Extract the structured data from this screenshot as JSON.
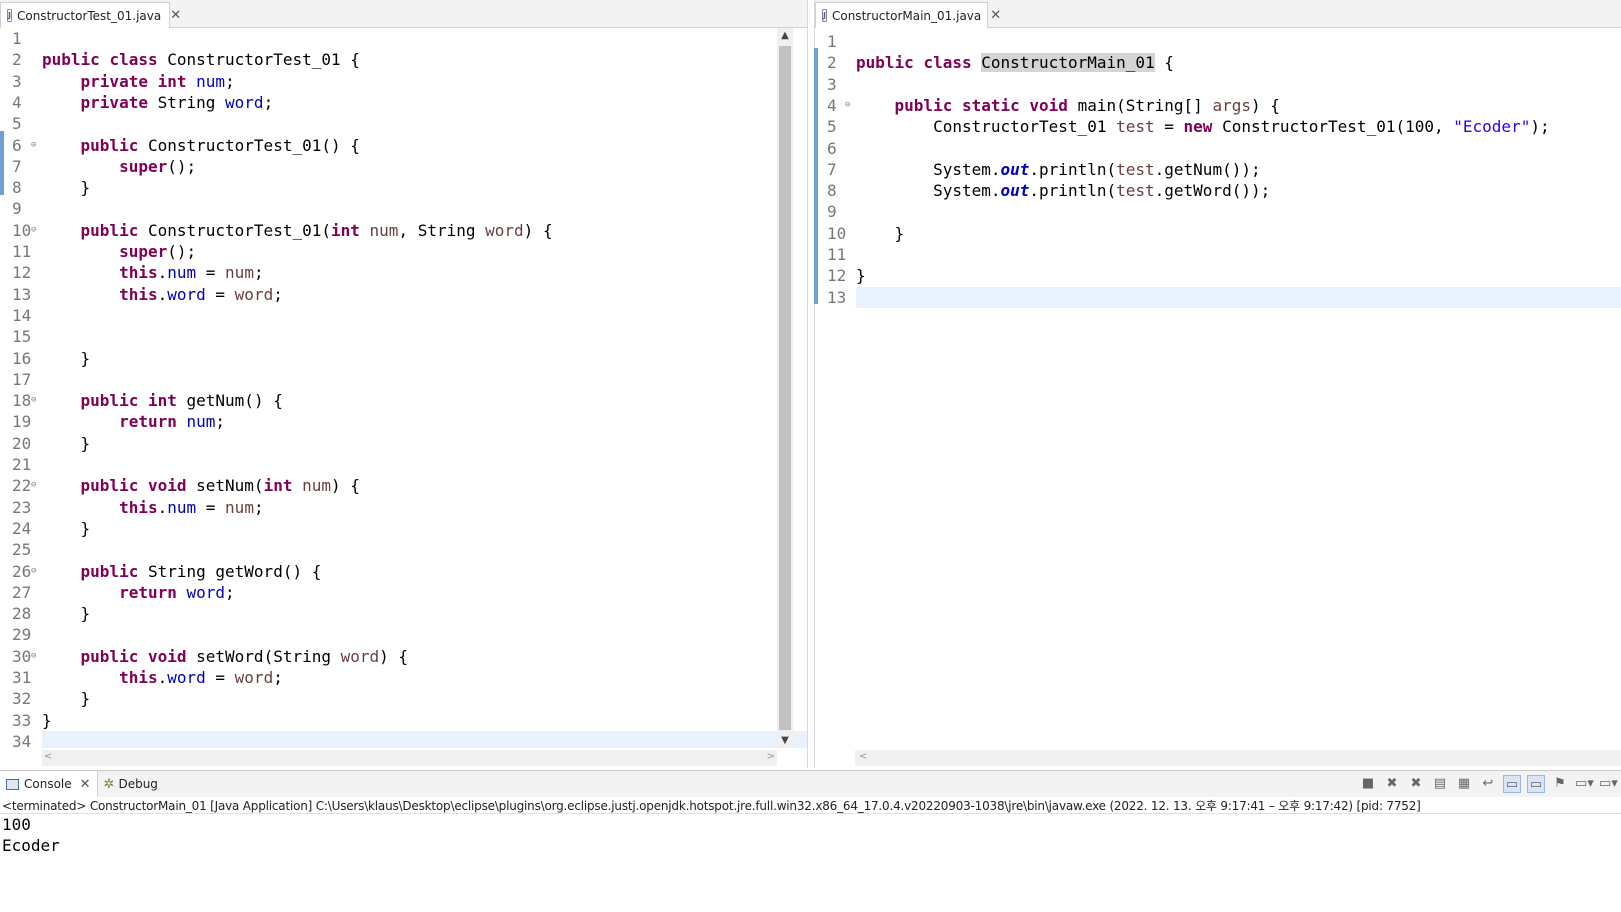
{
  "left_editor": {
    "tab_label": "ConstructorTest_01.java",
    "lines": [
      {
        "n": "1",
        "html": ""
      },
      {
        "n": "2",
        "html": "<span class=\"kw\">public</span> <span class=\"kw\">class</span> ConstructorTest_01 {"
      },
      {
        "n": "3",
        "html": "    <span class=\"kw\">private</span> <span class=\"kw\">int</span> <span class=\"fld\">num</span>;"
      },
      {
        "n": "4",
        "html": "    <span class=\"kw\">private</span> String <span class=\"fld\">word</span>;"
      },
      {
        "n": "5",
        "html": ""
      },
      {
        "n": "6",
        "fold": true,
        "html": "    <span class=\"kw\">public</span> ConstructorTest_01() {"
      },
      {
        "n": "7",
        "html": "        <span class=\"kw\">super</span>();"
      },
      {
        "n": "8",
        "html": "    }"
      },
      {
        "n": "9",
        "html": ""
      },
      {
        "n": "10",
        "fold": true,
        "html": "    <span class=\"kw\">public</span> ConstructorTest_01(<span class=\"kw\">int</span> <span class=\"par\">num</span>, String <span class=\"par\">word</span>) {"
      },
      {
        "n": "11",
        "html": "        <span class=\"kw\">super</span>();"
      },
      {
        "n": "12",
        "html": "        <span class=\"kw\">this</span>.<span class=\"fld\">num</span> = <span class=\"par\">num</span>;"
      },
      {
        "n": "13",
        "html": "        <span class=\"kw\">this</span>.<span class=\"fld\">word</span> = <span class=\"par\">word</span>;"
      },
      {
        "n": "14",
        "html": ""
      },
      {
        "n": "15",
        "html": ""
      },
      {
        "n": "16",
        "html": "    }"
      },
      {
        "n": "17",
        "html": ""
      },
      {
        "n": "18",
        "fold": true,
        "html": "    <span class=\"kw\">public</span> <span class=\"kw\">int</span> getNum() {"
      },
      {
        "n": "19",
        "html": "        <span class=\"kw\">return</span> <span class=\"fld\">num</span>;"
      },
      {
        "n": "20",
        "html": "    }"
      },
      {
        "n": "21",
        "html": ""
      },
      {
        "n": "22",
        "fold": true,
        "html": "    <span class=\"kw\">public</span> <span class=\"kw\">void</span> setNum(<span class=\"kw\">int</span> <span class=\"par\">num</span>) {"
      },
      {
        "n": "23",
        "html": "        <span class=\"kw\">this</span>.<span class=\"fld\">num</span> = <span class=\"par\">num</span>;"
      },
      {
        "n": "24",
        "html": "    }"
      },
      {
        "n": "25",
        "html": ""
      },
      {
        "n": "26",
        "fold": true,
        "html": "    <span class=\"kw\">public</span> String getWord() {"
      },
      {
        "n": "27",
        "html": "        <span class=\"kw\">return</span> <span class=\"fld\">word</span>;"
      },
      {
        "n": "28",
        "html": "    }"
      },
      {
        "n": "29",
        "html": ""
      },
      {
        "n": "30",
        "fold": true,
        "html": "    <span class=\"kw\">public</span> <span class=\"kw\">void</span> setWord(String <span class=\"par\">word</span>) {"
      },
      {
        "n": "31",
        "html": "        <span class=\"kw\">this</span>.<span class=\"fld\">word</span> = <span class=\"par\">word</span>;"
      },
      {
        "n": "32",
        "html": "    }"
      },
      {
        "n": "33",
        "html": "}"
      },
      {
        "n": "34",
        "html": "",
        "current": true
      }
    ]
  },
  "right_editor": {
    "tab_label": "ConstructorMain_01.java",
    "lines": [
      {
        "n": "1",
        "html": ""
      },
      {
        "n": "2",
        "html": "<span class=\"kw\">public</span> <span class=\"kw\">class</span> <span class=\"sel\">ConstructorMain_01</span> {"
      },
      {
        "n": "3",
        "html": ""
      },
      {
        "n": "4",
        "fold": true,
        "html": "    <span class=\"kw\">public</span> <span class=\"kw\">static</span> <span class=\"kw\">void</span> main(String[] <span class=\"par\">args</span>) {"
      },
      {
        "n": "5",
        "html": "        ConstructorTest_01 <span class=\"par\">test</span> = <span class=\"kw\">new</span> ConstructorTest_01(100, <span class=\"str\">\"Ecoder\"</span>);"
      },
      {
        "n": "6",
        "html": ""
      },
      {
        "n": "7",
        "html": "        System.<span class=\"sfld\">out</span>.println(<span class=\"par\">test</span>.getNum());"
      },
      {
        "n": "8",
        "html": "        System.<span class=\"sfld\">out</span>.println(<span class=\"par\">test</span>.getWord());"
      },
      {
        "n": "9",
        "html": ""
      },
      {
        "n": "10",
        "html": "    }"
      },
      {
        "n": "11",
        "html": ""
      },
      {
        "n": "12",
        "html": "}"
      },
      {
        "n": "13",
        "html": "",
        "current": true
      }
    ]
  },
  "console": {
    "tab_console": "Console",
    "tab_debug": "Debug",
    "status": "<terminated> ConstructorMain_01 [Java Application] C:\\Users\\klaus\\Desktop\\eclipse\\plugins\\org.eclipse.justj.openjdk.hotspot.jre.full.win32.x86_64_17.0.4.v20220903-1038\\jre\\bin\\javaw.exe  (2022. 12. 13. 오후 9:17:41 – 오후 9:17:42) [pid: 7752]",
    "output": [
      "100",
      "Ecoder"
    ]
  },
  "icons": {
    "scroll_up": "▲",
    "scroll_down": "▼",
    "scroll_left": "<",
    "scroll_right": ">",
    "close": "✕",
    "fold": "⊖",
    "bug": "✲",
    "java_file": "J"
  }
}
